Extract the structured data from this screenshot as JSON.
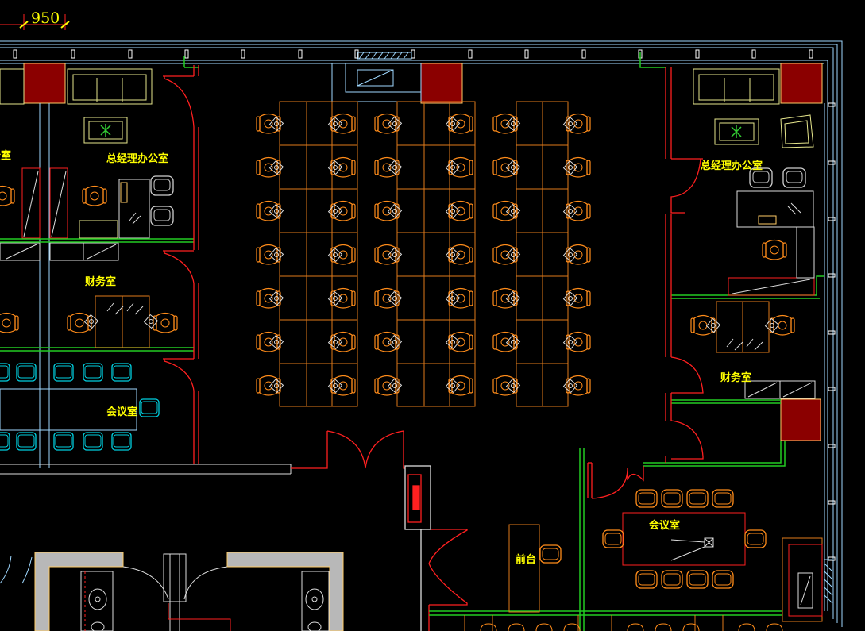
{
  "dimension": {
    "value": "950"
  },
  "rooms": {
    "gm_office_left": "总经理办公室",
    "gm_office_left_partial": "公室",
    "gm_office_right": "总经理办公室",
    "finance_left": "财务室",
    "finance_right": "财务室",
    "meeting_left": "会议室",
    "meeting_right": "会议室",
    "reception": "前台"
  },
  "colors": {
    "background": "#000000",
    "outer_wall": "#9fd8ff",
    "partition_red": "#ff2020",
    "partition_green": "#22cc22",
    "furniture_orange": "#ff8c1a",
    "desk_outline": "#e07a1a",
    "sofa_yellow": "#e6e68c",
    "column_fill": "#8b0000",
    "cyan_chairs": "#00d0e0",
    "grey_wall": "#b8b8b8",
    "text": "#ffff00"
  },
  "icons": [
    "office-chair-icon",
    "sofa-icon",
    "plant-icon",
    "door-swing-icon",
    "fire-extinguisher-icon",
    "sink-icon"
  ]
}
